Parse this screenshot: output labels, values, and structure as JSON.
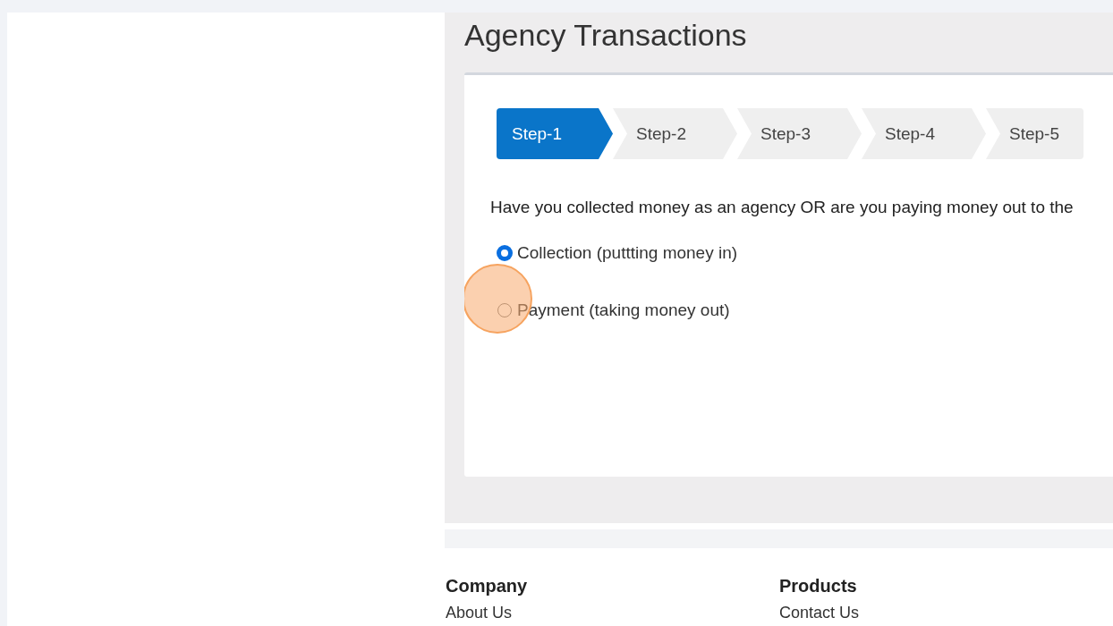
{
  "page": {
    "title": "Agency Transactions"
  },
  "steps": [
    {
      "label": "Step-1",
      "selected": true
    },
    {
      "label": "Step-2",
      "selected": false
    },
    {
      "label": "Step-3",
      "selected": false
    },
    {
      "label": "Step-4",
      "selected": false
    },
    {
      "label": "Step-5",
      "selected": false
    }
  ],
  "question": "Have you collected money as an agency OR are you paying money out to the",
  "options": [
    {
      "label": "Collection (puttting money in)",
      "selected": true
    },
    {
      "label": "Payment (taking money out)",
      "selected": false
    }
  ],
  "footer": {
    "columns": [
      {
        "heading": "Company",
        "links": [
          "About Us"
        ]
      },
      {
        "heading": "Products",
        "links": [
          "Contact Us"
        ]
      }
    ]
  }
}
